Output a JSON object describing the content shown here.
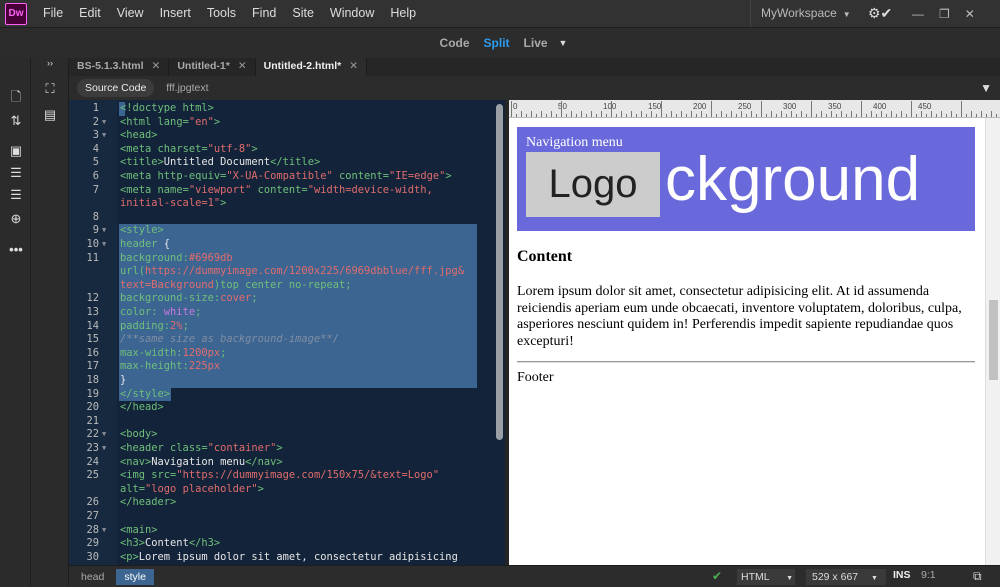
{
  "menubar": {
    "logo": "Dw",
    "items": [
      "File",
      "Edit",
      "View",
      "Insert",
      "Tools",
      "Find",
      "Site",
      "Window",
      "Help"
    ],
    "workspace": "MyWorkspace"
  },
  "viewbar": {
    "code": "Code",
    "split": "Split",
    "live": "Live"
  },
  "tabs": [
    {
      "label": "BS-5.1.3.html"
    },
    {
      "label": "Untitled-1*"
    },
    {
      "label": "Untitled-2.html*"
    }
  ],
  "related": {
    "source": "Source Code",
    "file": "fff.jpgtext"
  },
  "code_lines": [
    {
      "n": "1",
      "fold": "",
      "sel": true,
      "tokens": [
        [
          "t",
          "<!doctype html>"
        ]
      ]
    },
    {
      "n": "2",
      "fold": "▼",
      "sel": false,
      "tokens": [
        [
          "t",
          "<html "
        ],
        [
          "a",
          "lang="
        ],
        [
          "v",
          "\"en\""
        ],
        [
          "t",
          ">"
        ]
      ]
    },
    {
      "n": "3",
      "fold": "▼",
      "sel": false,
      "tokens": [
        [
          "t",
          "<head>"
        ]
      ]
    },
    {
      "n": "4",
      "fold": "",
      "sel": false,
      "tokens": [
        [
          "t",
          "<meta "
        ],
        [
          "a",
          "charset="
        ],
        [
          "v",
          "\"utf-8\""
        ],
        [
          "t",
          ">"
        ]
      ]
    },
    {
      "n": "5",
      "fold": "",
      "sel": false,
      "tokens": [
        [
          "t",
          "<title>"
        ],
        [
          "txt",
          "Untitled Document"
        ],
        [
          "t",
          "</title>"
        ]
      ]
    },
    {
      "n": "6",
      "fold": "",
      "sel": false,
      "tokens": [
        [
          "t",
          "<meta "
        ],
        [
          "a",
          "http-equiv="
        ],
        [
          "v",
          "\"X-UA-Compatible\""
        ],
        [
          "a",
          " content="
        ],
        [
          "v",
          "\"IE=edge\""
        ],
        [
          "t",
          ">"
        ]
      ]
    },
    {
      "n": "7",
      "fold": "",
      "sel": false,
      "tokens": [
        [
          "t",
          "<meta "
        ],
        [
          "a",
          "name="
        ],
        [
          "v",
          "\"viewport\""
        ],
        [
          "a",
          " content="
        ],
        [
          "v",
          "\"width=device-width,"
        ]
      ]
    },
    {
      "n": "",
      "fold": "",
      "sel": false,
      "tokens": [
        [
          "v",
          "initial-scale=1\""
        ],
        [
          "t",
          ">"
        ]
      ]
    },
    {
      "n": "8",
      "fold": "",
      "sel": false,
      "tokens": []
    },
    {
      "n": "9",
      "fold": "▼",
      "sel": true,
      "tokens": [
        [
          "t",
          "<style>"
        ]
      ]
    },
    {
      "n": "10",
      "fold": "▼",
      "sel": true,
      "tokens": [
        [
          "p",
          "header "
        ],
        [
          "txt",
          "{"
        ]
      ]
    },
    {
      "n": "11",
      "fold": "",
      "sel": true,
      "tokens": [
        [
          "p",
          "background:"
        ],
        [
          "v",
          "#6969db"
        ]
      ]
    },
    {
      "n": "",
      "fold": "",
      "sel": true,
      "tokens": [
        [
          "p",
          "url("
        ],
        [
          "v",
          "https://dummyimage.com/1200x225/6969dbblue/fff.jpg&"
        ]
      ]
    },
    {
      "n": "",
      "fold": "",
      "sel": true,
      "tokens": [
        [
          "v",
          "text=Background"
        ],
        [
          "p",
          ")top center no-repeat;"
        ]
      ]
    },
    {
      "n": "12",
      "fold": "",
      "sel": true,
      "tokens": [
        [
          "p",
          "background-size:"
        ],
        [
          "v",
          "cover"
        ],
        [
          "p",
          ";"
        ]
      ]
    },
    {
      "n": "13",
      "fold": "",
      "sel": true,
      "tokens": [
        [
          "p",
          "color: "
        ],
        [
          "w",
          "white"
        ],
        [
          "p",
          ";"
        ]
      ]
    },
    {
      "n": "14",
      "fold": "",
      "sel": true,
      "tokens": [
        [
          "p",
          "padding:"
        ],
        [
          "v",
          "2%"
        ],
        [
          "p",
          ";"
        ]
      ]
    },
    {
      "n": "15",
      "fold": "",
      "sel": true,
      "tokens": [
        [
          "c",
          "/**same size as background-image**/"
        ]
      ]
    },
    {
      "n": "16",
      "fold": "",
      "sel": true,
      "tokens": [
        [
          "p",
          "max-width:"
        ],
        [
          "v",
          "1200px"
        ],
        [
          "p",
          ";"
        ]
      ]
    },
    {
      "n": "17",
      "fold": "",
      "sel": true,
      "tokens": [
        [
          "p",
          "max-height:"
        ],
        [
          "v",
          "225px"
        ]
      ]
    },
    {
      "n": "18",
      "fold": "",
      "sel": true,
      "tokens": [
        [
          "txt",
          "}"
        ]
      ]
    },
    {
      "n": "19",
      "fold": "",
      "sel": true,
      "tokens": [
        [
          "t",
          "</style>"
        ]
      ]
    },
    {
      "n": "20",
      "fold": "",
      "sel": false,
      "tokens": [
        [
          "t",
          "</head>"
        ]
      ]
    },
    {
      "n": "21",
      "fold": "",
      "sel": false,
      "tokens": []
    },
    {
      "n": "22",
      "fold": "▼",
      "sel": false,
      "tokens": [
        [
          "t",
          "<body>"
        ]
      ]
    },
    {
      "n": "23",
      "fold": "▼",
      "sel": false,
      "tokens": [
        [
          "t",
          "<header "
        ],
        [
          "a",
          "class="
        ],
        [
          "v",
          "\"container\""
        ],
        [
          "t",
          ">"
        ]
      ]
    },
    {
      "n": "24",
      "fold": "",
      "sel": false,
      "tokens": [
        [
          "t",
          "<nav>"
        ],
        [
          "txt",
          "Navigation menu"
        ],
        [
          "t",
          "</nav>"
        ]
      ]
    },
    {
      "n": "25",
      "fold": "",
      "sel": false,
      "tokens": [
        [
          "t",
          "<img "
        ],
        [
          "a",
          "src="
        ],
        [
          "v",
          "\"https://dummyimage.com/150x75/&text=Logo\""
        ]
      ]
    },
    {
      "n": "",
      "fold": "",
      "sel": false,
      "tokens": [
        [
          "a",
          "alt="
        ],
        [
          "v",
          "\"logo placeholder\""
        ],
        [
          "t",
          ">"
        ]
      ]
    },
    {
      "n": "26",
      "fold": "",
      "sel": false,
      "tokens": [
        [
          "t",
          "</header>"
        ]
      ]
    },
    {
      "n": "27",
      "fold": "",
      "sel": false,
      "tokens": []
    },
    {
      "n": "28",
      "fold": "▼",
      "sel": false,
      "tokens": [
        [
          "t",
          "<main>"
        ]
      ]
    },
    {
      "n": "29",
      "fold": "",
      "sel": false,
      "tokens": [
        [
          "t",
          "<h3>"
        ],
        [
          "txt",
          "Content"
        ],
        [
          "t",
          "</h3>"
        ]
      ]
    },
    {
      "n": "30",
      "fold": "",
      "sel": false,
      "tokens": [
        [
          "t",
          "<p>"
        ],
        [
          "txt",
          "Lorem ipsum dolor sit amet, consectetur adipisicing"
        ]
      ]
    }
  ],
  "ruler": [
    "0",
    "50",
    "100",
    "150",
    "200",
    "250",
    "300",
    "350",
    "400",
    "450"
  ],
  "preview": {
    "nav": "Navigation menu",
    "logo": "Logo",
    "bg_text": "ckground",
    "heading": "Content",
    "paragraph": "Lorem ipsum dolor sit amet, consectetur adipisicing elit. At id assumenda reiciendis aperiam eum unde obcaecati, inventore voluptatem, doloribus, culpa, asperiores nesciunt quidem in! Perferendis impedit sapiente repudiandae quos excepturi!",
    "footer": "Footer",
    "header_color": "#6969db"
  },
  "status": {
    "crumbs": [
      "head",
      "style"
    ],
    "language": "HTML",
    "size": "529 x 667",
    "mode": "INS",
    "position": "9:1"
  }
}
